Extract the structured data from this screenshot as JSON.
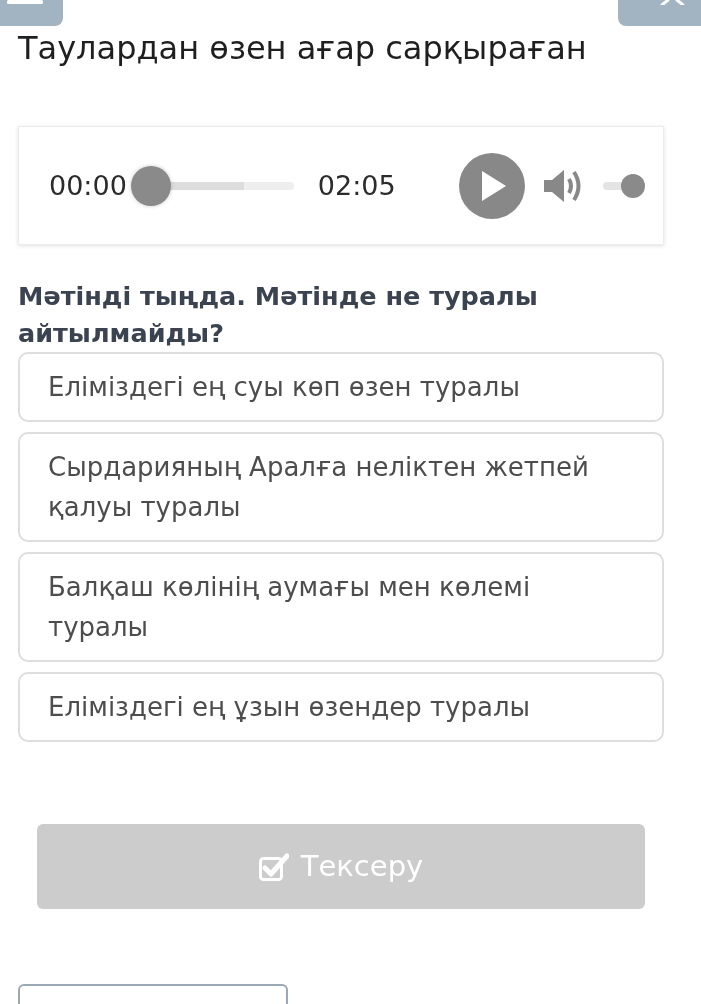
{
  "title": "Таулардан өзен ағар сарқыраған",
  "audio_player": {
    "current_time": "00:00",
    "duration": "02:05",
    "playing": false,
    "seek": {
      "level": 0
    },
    "buffer": {
      "level": 0.65
    },
    "volume": {
      "level": 0.73
    }
  },
  "question": "Мәтінді тыңда. Мәтінде не туралы айтылмайды?",
  "options": [
    {
      "text": "Еліміздегі ең суы көп өзен туралы",
      "selected": false
    },
    {
      "text": "Сырдарияның Аралға неліктен жетпей қалуы туралы",
      "selected": false
    },
    {
      "text": "Балқаш көлінің аумағы мен көлемі туралы",
      "selected": false
    },
    {
      "text": "Еліміздегі ең ұзын өзендер туралы",
      "selected": false
    }
  ],
  "check_button": {
    "label": "Тексеру",
    "disabled": true
  }
}
